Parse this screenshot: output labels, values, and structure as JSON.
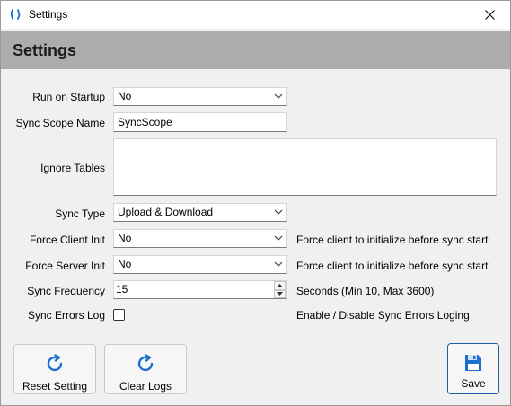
{
  "window": {
    "title": "Settings"
  },
  "header": {
    "title": "Settings"
  },
  "form": {
    "run_on_startup": {
      "label": "Run on Startup",
      "value": "No"
    },
    "sync_scope_name": {
      "label": "Sync Scope Name",
      "value": "SyncScope"
    },
    "ignore_tables": {
      "label": "Ignore Tables",
      "value": ""
    },
    "sync_type": {
      "label": "Sync Type",
      "value": "Upload & Download"
    },
    "force_client_init": {
      "label": "Force Client Init",
      "value": "No",
      "hint": "Force client to initialize before sync start"
    },
    "force_server_init": {
      "label": "Force Server Init",
      "value": "No",
      "hint": "Force client to initialize before sync start"
    },
    "sync_frequency": {
      "label": "Sync Frequency",
      "value": "15",
      "hint": "Seconds (Min 10, Max 3600)"
    },
    "sync_errors_log": {
      "label": "Sync Errors Log",
      "checked": false,
      "hint": "Enable / Disable Sync Errors Loging"
    }
  },
  "buttons": {
    "reset": "Reset Setting",
    "clear_logs": "Clear Logs",
    "save": "Save"
  },
  "colors": {
    "accent": "#1c6fd1",
    "header_bg": "#acacac"
  },
  "icons": [
    "sync-app-icon",
    "close-icon",
    "chevron-down-icon",
    "refresh-icon",
    "floppy-disk-icon"
  ]
}
